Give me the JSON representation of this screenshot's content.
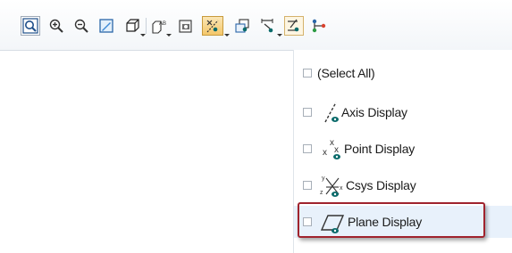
{
  "toolbar": {
    "buttons": [
      {
        "name": "refit-icon"
      },
      {
        "name": "zoom-in-icon"
      },
      {
        "name": "zoom-out-icon"
      },
      {
        "name": "repaint-icon"
      },
      {
        "name": "display-style-icon"
      },
      {
        "name": "saved-orientations-icon"
      },
      {
        "name": "view-manager-icon"
      },
      {
        "name": "datum-display-filters-icon"
      },
      {
        "name": "spin-center-icon"
      },
      {
        "name": "annotation-display-icon"
      },
      {
        "name": "axis-tag-display-icon"
      },
      {
        "name": "node-display-icon"
      }
    ]
  },
  "menu": {
    "items": [
      {
        "label": "(Select All)",
        "icon": "none"
      },
      {
        "label": "Axis Display",
        "icon": "axis-display-icon"
      },
      {
        "label": "Point Display",
        "icon": "point-display-icon"
      },
      {
        "label": "Csys Display",
        "icon": "csys-display-icon"
      },
      {
        "label": "Plane Display",
        "icon": "plane-display-icon"
      }
    ]
  },
  "colors": {
    "highlight_border": "#a0232d",
    "hover_background": "#e8f1fb",
    "eye_icon": "#0b6b6b"
  }
}
